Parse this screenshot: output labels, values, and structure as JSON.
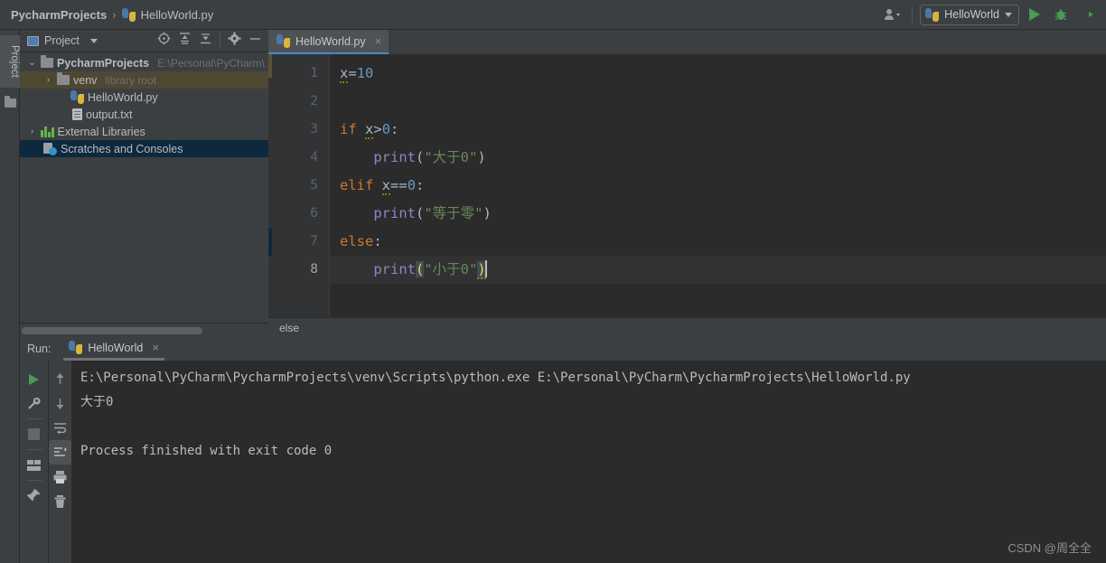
{
  "window": {
    "breadcrumb": [
      {
        "label": "PycharmProjects",
        "icon": "none",
        "bold": true
      },
      {
        "label": "HelloWorld.py",
        "icon": "python-file-icon",
        "bold": false
      }
    ],
    "separator": "›"
  },
  "toolbar": {
    "user_icon": "user-accounts-icon",
    "run_config_name": "HelloWorld",
    "run_config_icon": "python-file-icon",
    "run_button": "run-icon",
    "debug_button": "debug-icon",
    "coverage_button": "run-with-coverage-icon"
  },
  "left_strip": {
    "project_label": "Project",
    "folder_icon": "folder-icon"
  },
  "project_panel": {
    "title": "Project",
    "window_icon": "project-view-icon",
    "tools": [
      "locate-icon",
      "expand-all-icon",
      "collapse-all-icon",
      "settings-gear-icon",
      "hide-icon"
    ],
    "tree": [
      {
        "label": "PycharmProjects",
        "sub": "E:\\Personal\\PyCharm\\",
        "icon": "folder-icon",
        "arrow": "⌄",
        "indent": 0,
        "bold": true,
        "state": "normal"
      },
      {
        "label": "venv",
        "sub": "library root",
        "icon": "folder-icon",
        "arrow": "›",
        "indent": 1,
        "bold": false,
        "state": "venv-highlight"
      },
      {
        "label": "HelloWorld.py",
        "sub": "",
        "icon": "python-file-icon",
        "arrow": "",
        "indent": 2,
        "bold": false,
        "state": "normal"
      },
      {
        "label": "output.txt",
        "sub": "",
        "icon": "text-file-icon",
        "arrow": "",
        "indent": 2,
        "bold": false,
        "state": "normal"
      },
      {
        "label": "External Libraries",
        "sub": "",
        "icon": "libraries-icon",
        "arrow": "›",
        "indent": 0,
        "bold": false,
        "state": "normal"
      },
      {
        "label": "Scratches and Consoles",
        "sub": "",
        "icon": "scratches-icon",
        "arrow": "",
        "indent": 1,
        "bold": false,
        "state": "selected"
      }
    ]
  },
  "editor": {
    "tab": {
      "label": "HelloWorld.py",
      "icon": "python-file-icon",
      "close": "×"
    },
    "line_numbers": [
      "1",
      "2",
      "3",
      "4",
      "5",
      "6",
      "7",
      "8"
    ],
    "current_line": 8,
    "code_lines": [
      {
        "n": 1,
        "tokens": [
          {
            "t": "x",
            "c": "var-squiggle"
          },
          {
            "t": "=",
            "c": "op"
          },
          {
            "t": "10",
            "c": "num"
          }
        ]
      },
      {
        "n": 2,
        "tokens": []
      },
      {
        "n": 3,
        "tokens": [
          {
            "t": "if",
            "c": "k"
          },
          {
            "t": " ",
            "c": "op"
          },
          {
            "t": "x",
            "c": "var-squiggle"
          },
          {
            "t": ">",
            "c": "op"
          },
          {
            "t": "0",
            "c": "num"
          },
          {
            "t": ":",
            "c": "op"
          }
        ]
      },
      {
        "n": 4,
        "tokens": [
          {
            "t": "    ",
            "c": "op"
          },
          {
            "t": "print",
            "c": "fn"
          },
          {
            "t": "(",
            "c": "op"
          },
          {
            "t": "\"大于0\"",
            "c": "str"
          },
          {
            "t": ")",
            "c": "op"
          }
        ]
      },
      {
        "n": 5,
        "tokens": [
          {
            "t": "elif",
            "c": "k"
          },
          {
            "t": " ",
            "c": "op"
          },
          {
            "t": "x",
            "c": "var-squiggle"
          },
          {
            "t": "==",
            "c": "op"
          },
          {
            "t": "0",
            "c": "num"
          },
          {
            "t": ":",
            "c": "op"
          }
        ]
      },
      {
        "n": 6,
        "tokens": [
          {
            "t": "    ",
            "c": "op"
          },
          {
            "t": "print",
            "c": "fn"
          },
          {
            "t": "(",
            "c": "op"
          },
          {
            "t": "\"等于零\"",
            "c": "str"
          },
          {
            "t": ")",
            "c": "op"
          }
        ]
      },
      {
        "n": 7,
        "tokens": [
          {
            "t": "else",
            "c": "k"
          },
          {
            "t": ":",
            "c": "op"
          }
        ]
      },
      {
        "n": 8,
        "tokens": [
          {
            "t": "    ",
            "c": "op"
          },
          {
            "t": "print",
            "c": "fn"
          },
          {
            "t": "(",
            "c": "brkt"
          },
          {
            "t": "\"小于0\"",
            "c": "str"
          },
          {
            "t": ")",
            "c": "brkt"
          }
        ]
      }
    ],
    "code_plain": [
      "x=10",
      "",
      "if x>0:",
      "    print(\"大于0\")",
      "elif x==0:",
      "    print(\"等于零\")",
      "else:",
      "    print(\"小于0\")"
    ],
    "breadcrumb": "else"
  },
  "run_panel": {
    "label": "Run:",
    "tab": {
      "label": "HelloWorld",
      "icon": "python-file-icon",
      "close": "×"
    },
    "tools_left": [
      "rerun-icon",
      "settings-wrench-icon",
      "stop-icon",
      "layout-icon",
      "pin-icon"
    ],
    "tools_right": [
      "up-arrow-icon",
      "down-arrow-icon",
      "soft-wrap-icon",
      "scroll-to-end-icon",
      "print-icon",
      "trash-icon"
    ],
    "console_lines": [
      "E:\\Personal\\PyCharm\\PycharmProjects\\venv\\Scripts\\python.exe E:\\Personal\\PyCharm\\PycharmProjects\\HelloWorld.py",
      "大于0",
      "",
      "Process finished with exit code 0"
    ]
  },
  "watermark": "CSDN @周全全",
  "colors": {
    "background": "#3c3f41",
    "editor_bg": "#2b2b2b",
    "accent_blue": "#4a88c7",
    "run_green": "#499c54",
    "keyword_orange": "#cc7832",
    "string_green": "#6a8759",
    "number_blue": "#6897bb",
    "function_violet": "#8888c6",
    "selection_blue": "#0d293e",
    "venv_highlight": "#4e4833"
  }
}
